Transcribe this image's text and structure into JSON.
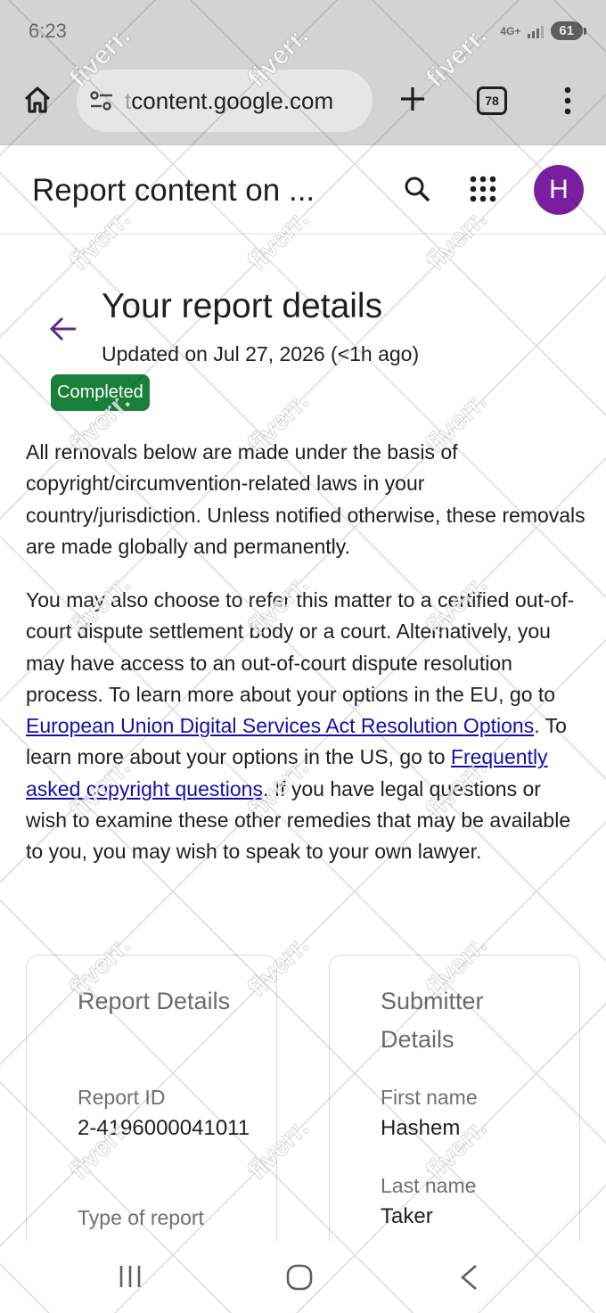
{
  "status_bar": {
    "time": "6:23",
    "network": "4G+",
    "battery": "61"
  },
  "browser": {
    "url_prefix": "t",
    "url": "content.google.com",
    "tab_count": "78",
    "icons": [
      "home-icon",
      "tune-icon",
      "plus-icon",
      "tabs-icon",
      "more-vert-icon"
    ]
  },
  "header": {
    "title": "Report content on ...",
    "avatar_initial": "H",
    "avatar_color": "#7b1fa2",
    "icons": [
      "search-icon",
      "apps-grid-icon"
    ]
  },
  "report": {
    "title": "Your report details",
    "updated": "Updated on Jul 27, 2026 (<1h ago)",
    "status": "Completed",
    "status_color": "#188038",
    "paragraph1": "All removals below are made under the basis of copyright/circumvention-related laws in your country/jurisdiction. Unless notified otherwise, these removals are made globally and permanently.",
    "paragraph2": {
      "text1": "You may also choose to refer this matter to a certified out-of-court dispute settlement body or a court. Alternatively, you may have access to an out-of-court dispute resolution process. To learn more about your options in the EU, go to ",
      "link1": "European Union Digital Services Act Resolution Options",
      "text2": ". To learn more about your options in the US, go to ",
      "link2": "Frequently asked copyright questions",
      "text3": ". If you have legal questions or wish to examine these other remedies that may be available to you, you may wish to speak to your own lawyer."
    }
  },
  "report_details": {
    "title": "Report Details",
    "report_id_label": "Report ID",
    "report_id": "2-4196000041011",
    "type_label": "Type of report"
  },
  "submitter_details": {
    "title": "Submitter Details",
    "first_name_label": "First name",
    "first_name": "Hashem",
    "last_name_label": "Last name",
    "last_name": "Taker"
  },
  "nav_bar": {
    "icons": [
      "recents-icon",
      "home-circle-icon",
      "back-chevron-icon"
    ]
  },
  "watermark": {
    "text": "fiverr."
  }
}
